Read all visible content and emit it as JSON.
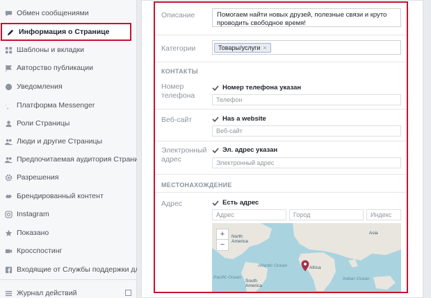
{
  "sidebar": {
    "items": [
      {
        "label": "Обмен сообщениями",
        "icon": "chat-icon"
      },
      {
        "label": "Информация о Странице",
        "icon": "pencil-icon",
        "active": true
      },
      {
        "label": "Шаблоны и вкладки",
        "icon": "grid-icon"
      },
      {
        "label": "Авторство публикации",
        "icon": "flag-icon"
      },
      {
        "label": "Уведомления",
        "icon": "globe-icon"
      },
      {
        "label": "Платформа Messenger",
        "icon": "messenger-icon"
      },
      {
        "label": "Роли Страницы",
        "icon": "person-icon"
      },
      {
        "label": "Люди и другие Страницы",
        "icon": "people-icon"
      },
      {
        "label": "Предпочитаемая аудитория Страницы",
        "icon": "people-icon"
      },
      {
        "label": "Разрешения",
        "icon": "gear-icon"
      },
      {
        "label": "Брендированный контент",
        "icon": "handshake-icon"
      },
      {
        "label": "Instagram",
        "icon": "instagram-icon"
      },
      {
        "label": "Показано",
        "icon": "star-icon"
      },
      {
        "label": "Кросспостинг",
        "icon": "video-icon"
      },
      {
        "label": "Входящие от Службы поддержки для Стр",
        "icon": "facebook-icon"
      }
    ],
    "activity_log": {
      "label": "Журнал действий",
      "icon": "list-icon"
    }
  },
  "form": {
    "description": {
      "label": "Описание",
      "value": "Помогаем найти новых друзей, полезные связи и круто проводить свободное время!"
    },
    "category": {
      "label": "Категории",
      "tag": "Товары/услуги",
      "remove": "×"
    },
    "contacts_title": "КОНТАКТЫ",
    "phone": {
      "label": "Номер телефона",
      "checkbox": "Номер телефона указан",
      "placeholder": "Телефон"
    },
    "website": {
      "label": "Веб-сайт",
      "checkbox": "Has a website",
      "placeholder": "Веб-сайт"
    },
    "email": {
      "label": "Электронный адрес",
      "checkbox": "Эл. адрес указан",
      "placeholder": "Электронный адрес"
    },
    "location_title": "МЕСТОНАХОЖДЕНИЕ",
    "address": {
      "label": "Адрес",
      "checkbox": "Есть адрес",
      "street_placeholder": "Адрес",
      "city_placeholder": "Город",
      "zip_placeholder": "Индекс"
    }
  },
  "map": {
    "zoom_in": "+",
    "zoom_out": "−",
    "labels": [
      "North America",
      "Asia",
      "Atlantic Ocean",
      "Africa",
      "South America",
      "Indian Ocean",
      "Pacific Ocean"
    ],
    "pin_color": "#a5324b"
  },
  "colors": {
    "highlight": "#c8102e",
    "ocean": "#a9d3df",
    "land": "#e8e6df"
  }
}
